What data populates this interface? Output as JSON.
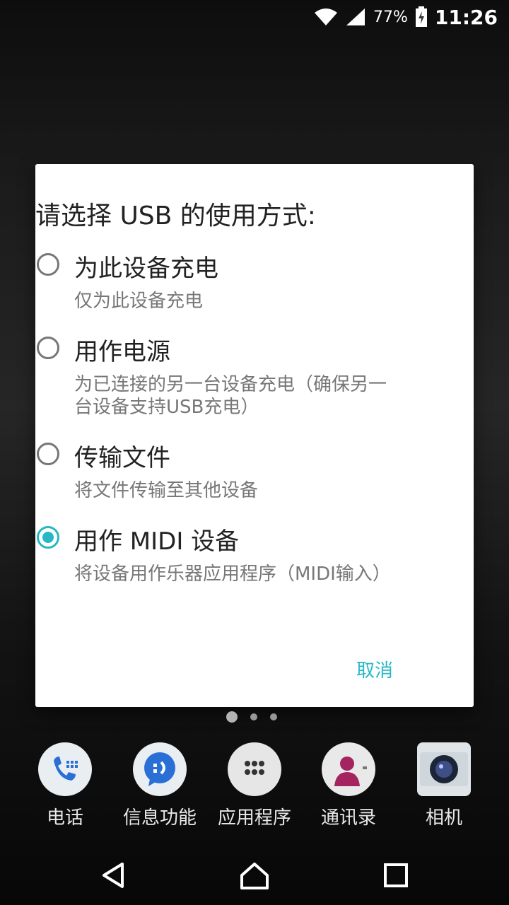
{
  "status_bar": {
    "battery_percent": "77%",
    "time": "11:26"
  },
  "dialog": {
    "title": "请选择 USB 的使用方式:",
    "options": [
      {
        "label": "为此设备充电",
        "description": "仅为此设备充电",
        "selected": false
      },
      {
        "label": "用作电源",
        "description": "为已连接的另一台设备充电（确保另一台设备支持USB充电）",
        "selected": false
      },
      {
        "label": "传输文件",
        "description": "将文件传输至其他设备",
        "selected": false
      },
      {
        "label": "用作 MIDI 设备",
        "description": "将设备用作乐器应用程序（MIDI输入）",
        "selected": true
      }
    ],
    "cancel_label": "取消"
  },
  "home_pages": {
    "count": 3,
    "active": 1
  },
  "dock": [
    {
      "label": "电话",
      "icon": "phone-icon"
    },
    {
      "label": "信息功能",
      "icon": "messaging-icon"
    },
    {
      "label": "应用程序",
      "icon": "app-drawer-icon"
    },
    {
      "label": "通讯录",
      "icon": "contacts-icon"
    },
    {
      "label": "相机",
      "icon": "camera-icon"
    }
  ],
  "nav_bar": {
    "back": "back-icon",
    "home": "home-icon",
    "recents": "recents-icon"
  },
  "colors": {
    "accent": "#26b8c6"
  }
}
